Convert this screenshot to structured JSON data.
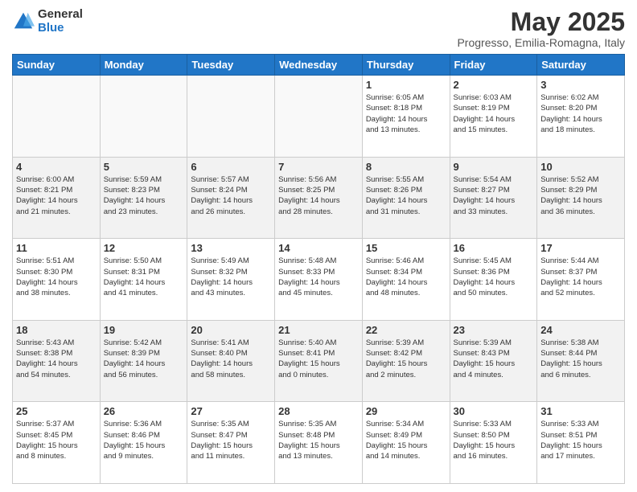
{
  "logo": {
    "general": "General",
    "blue": "Blue"
  },
  "title": "May 2025",
  "subtitle": "Progresso, Emilia-Romagna, Italy",
  "days_of_week": [
    "Sunday",
    "Monday",
    "Tuesday",
    "Wednesday",
    "Thursday",
    "Friday",
    "Saturday"
  ],
  "weeks": [
    [
      {
        "day": "",
        "info": ""
      },
      {
        "day": "",
        "info": ""
      },
      {
        "day": "",
        "info": ""
      },
      {
        "day": "",
        "info": ""
      },
      {
        "day": "1",
        "info": "Sunrise: 6:05 AM\nSunset: 8:18 PM\nDaylight: 14 hours\nand 13 minutes."
      },
      {
        "day": "2",
        "info": "Sunrise: 6:03 AM\nSunset: 8:19 PM\nDaylight: 14 hours\nand 15 minutes."
      },
      {
        "day": "3",
        "info": "Sunrise: 6:02 AM\nSunset: 8:20 PM\nDaylight: 14 hours\nand 18 minutes."
      }
    ],
    [
      {
        "day": "4",
        "info": "Sunrise: 6:00 AM\nSunset: 8:21 PM\nDaylight: 14 hours\nand 21 minutes."
      },
      {
        "day": "5",
        "info": "Sunrise: 5:59 AM\nSunset: 8:23 PM\nDaylight: 14 hours\nand 23 minutes."
      },
      {
        "day": "6",
        "info": "Sunrise: 5:57 AM\nSunset: 8:24 PM\nDaylight: 14 hours\nand 26 minutes."
      },
      {
        "day": "7",
        "info": "Sunrise: 5:56 AM\nSunset: 8:25 PM\nDaylight: 14 hours\nand 28 minutes."
      },
      {
        "day": "8",
        "info": "Sunrise: 5:55 AM\nSunset: 8:26 PM\nDaylight: 14 hours\nand 31 minutes."
      },
      {
        "day": "9",
        "info": "Sunrise: 5:54 AM\nSunset: 8:27 PM\nDaylight: 14 hours\nand 33 minutes."
      },
      {
        "day": "10",
        "info": "Sunrise: 5:52 AM\nSunset: 8:29 PM\nDaylight: 14 hours\nand 36 minutes."
      }
    ],
    [
      {
        "day": "11",
        "info": "Sunrise: 5:51 AM\nSunset: 8:30 PM\nDaylight: 14 hours\nand 38 minutes."
      },
      {
        "day": "12",
        "info": "Sunrise: 5:50 AM\nSunset: 8:31 PM\nDaylight: 14 hours\nand 41 minutes."
      },
      {
        "day": "13",
        "info": "Sunrise: 5:49 AM\nSunset: 8:32 PM\nDaylight: 14 hours\nand 43 minutes."
      },
      {
        "day": "14",
        "info": "Sunrise: 5:48 AM\nSunset: 8:33 PM\nDaylight: 14 hours\nand 45 minutes."
      },
      {
        "day": "15",
        "info": "Sunrise: 5:46 AM\nSunset: 8:34 PM\nDaylight: 14 hours\nand 48 minutes."
      },
      {
        "day": "16",
        "info": "Sunrise: 5:45 AM\nSunset: 8:36 PM\nDaylight: 14 hours\nand 50 minutes."
      },
      {
        "day": "17",
        "info": "Sunrise: 5:44 AM\nSunset: 8:37 PM\nDaylight: 14 hours\nand 52 minutes."
      }
    ],
    [
      {
        "day": "18",
        "info": "Sunrise: 5:43 AM\nSunset: 8:38 PM\nDaylight: 14 hours\nand 54 minutes."
      },
      {
        "day": "19",
        "info": "Sunrise: 5:42 AM\nSunset: 8:39 PM\nDaylight: 14 hours\nand 56 minutes."
      },
      {
        "day": "20",
        "info": "Sunrise: 5:41 AM\nSunset: 8:40 PM\nDaylight: 14 hours\nand 58 minutes."
      },
      {
        "day": "21",
        "info": "Sunrise: 5:40 AM\nSunset: 8:41 PM\nDaylight: 15 hours\nand 0 minutes."
      },
      {
        "day": "22",
        "info": "Sunrise: 5:39 AM\nSunset: 8:42 PM\nDaylight: 15 hours\nand 2 minutes."
      },
      {
        "day": "23",
        "info": "Sunrise: 5:39 AM\nSunset: 8:43 PM\nDaylight: 15 hours\nand 4 minutes."
      },
      {
        "day": "24",
        "info": "Sunrise: 5:38 AM\nSunset: 8:44 PM\nDaylight: 15 hours\nand 6 minutes."
      }
    ],
    [
      {
        "day": "25",
        "info": "Sunrise: 5:37 AM\nSunset: 8:45 PM\nDaylight: 15 hours\nand 8 minutes."
      },
      {
        "day": "26",
        "info": "Sunrise: 5:36 AM\nSunset: 8:46 PM\nDaylight: 15 hours\nand 9 minutes."
      },
      {
        "day": "27",
        "info": "Sunrise: 5:35 AM\nSunset: 8:47 PM\nDaylight: 15 hours\nand 11 minutes."
      },
      {
        "day": "28",
        "info": "Sunrise: 5:35 AM\nSunset: 8:48 PM\nDaylight: 15 hours\nand 13 minutes."
      },
      {
        "day": "29",
        "info": "Sunrise: 5:34 AM\nSunset: 8:49 PM\nDaylight: 15 hours\nand 14 minutes."
      },
      {
        "day": "30",
        "info": "Sunrise: 5:33 AM\nSunset: 8:50 PM\nDaylight: 15 hours\nand 16 minutes."
      },
      {
        "day": "31",
        "info": "Sunrise: 5:33 AM\nSunset: 8:51 PM\nDaylight: 15 hours\nand 17 minutes."
      }
    ]
  ]
}
